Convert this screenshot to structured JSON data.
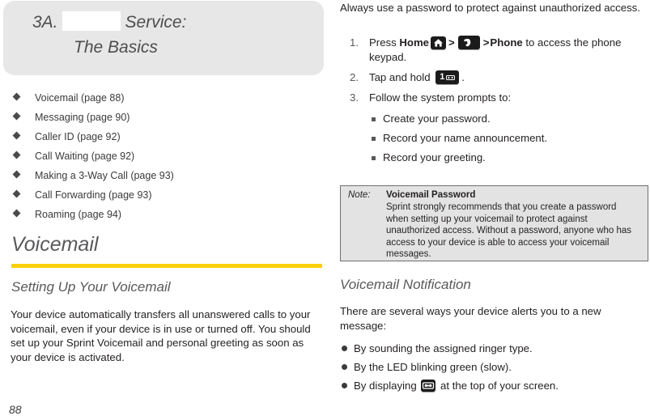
{
  "document": {
    "page_number": "88",
    "accent_rule_color": "#f9d006",
    "banner_bg_color": "#e7e7e7",
    "note_bg_color": "#e3e3e3"
  },
  "left_column": {
    "chapter_header": {
      "number": "3A.",
      "redacted_brand": "",
      "title_part": "Service:",
      "subtitle": "The Basics"
    },
    "contents_list": [
      {
        "label": "Voicemail (page 88)"
      },
      {
        "label": "Messaging (page 90)"
      },
      {
        "label": "Caller ID (page 92)"
      },
      {
        "label": "Call Waiting (page 92)"
      },
      {
        "label": "Making a 3-Way Call (page 93)"
      },
      {
        "label": "Call Forwarding (page 93)"
      },
      {
        "label": "Roaming (page 94)"
      }
    ],
    "section_heading": "Voicemail",
    "subsection_heading": "Setting Up Your Voicemail",
    "paragraph": "Your device automatically transfers all unanswered calls to your voicemail, even if your device is in use or turned off. You should set up your Sprint Voicemail and personal greeting as soon as your device is activated."
  },
  "right_column": {
    "intro_paragraph": "Always use a password to protect against unauthorized access.",
    "steps": [
      {
        "number": "1.",
        "text_before": "Press ",
        "bold_1": "Home",
        "icon_1": "home-key-icon",
        "separator_1": ">",
        "icon_2": "phone-key-icon",
        "separator_2": ">",
        "bold_2": "Phone",
        "text_after": " to access the phone keypad."
      },
      {
        "number": "2.",
        "text_before": "Tap and hold ",
        "icon_1": "one-voicemail-key-icon",
        "text_after": "."
      },
      {
        "number": "3.",
        "text_before": "Follow the system prompts to:",
        "sub_items": [
          "Create your password.",
          "Record your name announcement.",
          "Record your greeting."
        ]
      }
    ],
    "note": {
      "label": "Note:",
      "title": "Voicemail Password",
      "body": "Sprint strongly recommends that you create a password when setting up your voicemail to protect against unauthorized access. Without a password, anyone who has access to your device is able to access your voicemail messages."
    },
    "notification_heading": "Voicemail Notification",
    "notification_paragraph": "There are several ways your device alerts you to a new message:",
    "notification_items": [
      {
        "text_before": "By sounding the assigned ringer type.",
        "icon": null,
        "text_after": ""
      },
      {
        "text_before": "By the LED blinking green (slow).",
        "icon": null,
        "text_after": ""
      },
      {
        "text_before": "By displaying ",
        "icon": "voicemail-indicator-icon",
        "text_after": " at the top of your screen."
      }
    ]
  }
}
